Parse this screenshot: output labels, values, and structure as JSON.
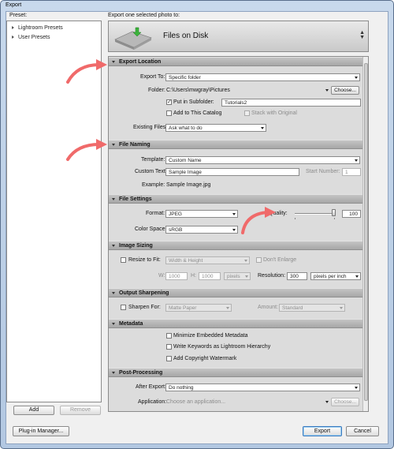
{
  "window": {
    "title": "Export"
  },
  "left": {
    "preset_label": "Preset:",
    "items": [
      "Lightroom Presets",
      "User Presets"
    ],
    "add": "Add",
    "remove": "Remove"
  },
  "header": {
    "export_label": "Export one selected photo to:",
    "destination": "Files on Disk"
  },
  "export_location": {
    "title": "Export Location",
    "export_to_label": "Export To:",
    "export_to_value": "Specific folder",
    "folder_label": "Folder:",
    "folder_path": "C:\\Users\\mwgray\\Pictures",
    "choose": "Choose...",
    "put_in_subfolder": "Put in Subfolder:",
    "subfolder": "Tutorials2",
    "add_to_catalog": "Add to This Catalog",
    "stack_with_original": "Stack with Original",
    "existing_files_label": "Existing Files:",
    "existing_files_value": "Ask what to do"
  },
  "file_naming": {
    "title": "File Naming",
    "template_label": "Template:",
    "template_value": "Custom Name",
    "custom_text_label": "Custom Text:",
    "custom_text_value": "Sample Image",
    "start_number_label": "Start Number:",
    "start_number_value": "1",
    "example_label": "Example:",
    "example_value": "Sample Image.jpg"
  },
  "file_settings": {
    "title": "File Settings",
    "format_label": "Format:",
    "format_value": "JPEG",
    "quality_label": "Quality:",
    "quality_value": "100",
    "quality_level": 100,
    "color_space_label": "Color Space:",
    "color_space_value": "sRGB"
  },
  "image_sizing": {
    "title": "Image Sizing",
    "resize_to_fit": "Resize to Fit:",
    "resize_value": "Width & Height",
    "dont_enlarge": "Don't Enlarge",
    "w_label": "W:",
    "w_value": "1000",
    "h_label": "H:",
    "h_value": "1000",
    "unit_value": "pixels",
    "resolution_label": "Resolution:",
    "resolution_value": "300",
    "resolution_unit": "pixels per inch"
  },
  "output_sharpening": {
    "title": "Output Sharpening",
    "sharpen_for": "Sharpen For:",
    "sharpen_value": "Matte Paper",
    "amount_label": "Amount:",
    "amount_value": "Standard"
  },
  "metadata": {
    "title": "Metadata",
    "minimize": "Minimize Embedded Metadata",
    "write_keywords": "Write Keywords as Lightroom Hierarchy",
    "add_watermark": "Add Copyright Watermark"
  },
  "post_processing": {
    "title": "Post-Processing",
    "after_export_label": "After Export:",
    "after_export_value": "Do nothing",
    "application_label": "Application:",
    "application_placeholder": "Choose an application...",
    "choose": "Choose..."
  },
  "footer": {
    "plugin_manager": "Plug-in Manager...",
    "export": "Export",
    "cancel": "Cancel"
  },
  "colors": {
    "annotation_arrow": "#f06a6a",
    "folder_icon_green": "#3bb33b"
  }
}
